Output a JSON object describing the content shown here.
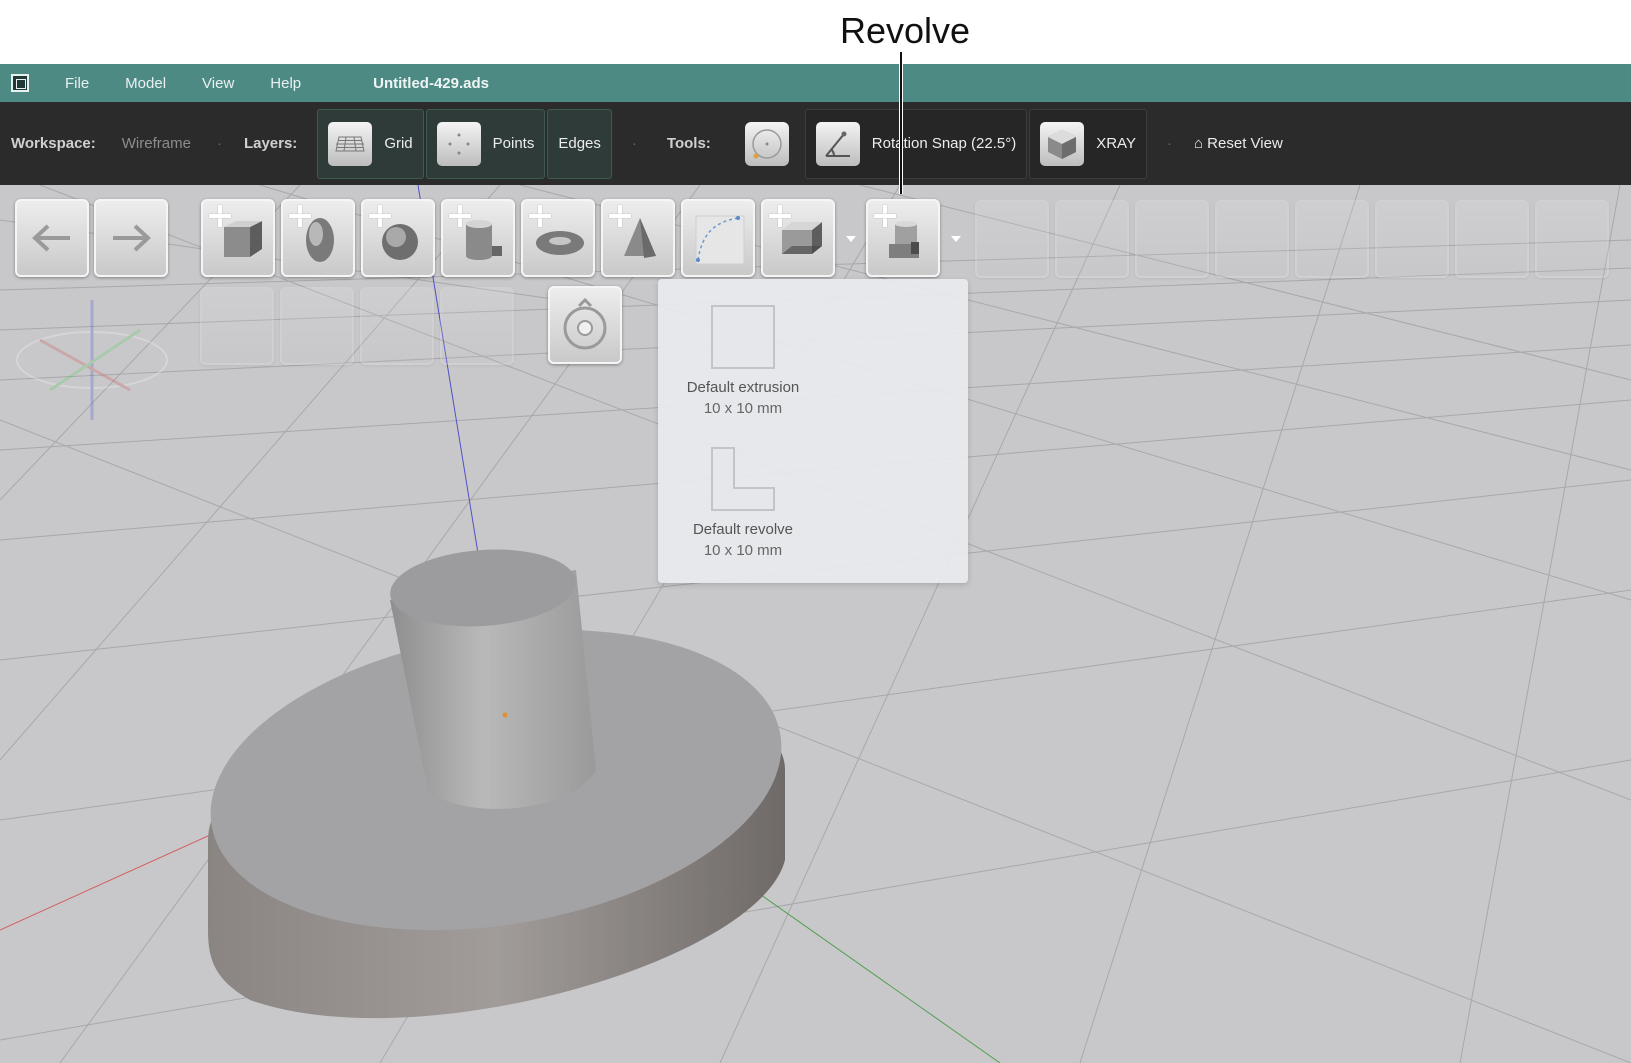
{
  "annotation": {
    "label": "Revolve"
  },
  "menubar": {
    "items": [
      "File",
      "Model",
      "View",
      "Help"
    ],
    "document_title": "Untitled-429.ads"
  },
  "toolbar": {
    "workspace_label": "Workspace:",
    "workspace_value": "Wireframe",
    "layers_label": "Layers:",
    "layers": [
      {
        "label": "Grid",
        "icon": "grid-icon",
        "active": true
      },
      {
        "label": "Points",
        "icon": "points-icon",
        "active": true
      },
      {
        "label": "Edges",
        "icon": "",
        "active": true
      }
    ],
    "tools_label": "Tools:",
    "rotation_snap_label": "Rotation Snap (22.5°)",
    "xray_label": "XRAY",
    "reset_view_label": "⌂ Reset View"
  },
  "tool_buttons": [
    {
      "name": "undo-button",
      "icon": "arrow-left-icon"
    },
    {
      "name": "redo-button",
      "icon": "arrow-right-icon"
    },
    {
      "name": "add-box-button",
      "icon": "box-icon"
    },
    {
      "name": "add-ellipsoid-button",
      "icon": "ellipsoid-icon"
    },
    {
      "name": "add-sphere-button",
      "icon": "sphere-icon"
    },
    {
      "name": "add-cylinder-button",
      "icon": "cylinder-icon"
    },
    {
      "name": "add-torus-button",
      "icon": "torus-icon"
    },
    {
      "name": "add-cone-button",
      "icon": "cone-icon"
    },
    {
      "name": "add-curve-button",
      "icon": "curve-icon"
    },
    {
      "name": "add-extrusion-button",
      "icon": "extrusion-icon"
    },
    {
      "name": "add-revolve-button",
      "icon": "revolve-icon"
    }
  ],
  "dropdown": {
    "items": [
      {
        "title": "Default extrusion",
        "size": "10 x 10 mm",
        "icon": "square-profile-icon"
      },
      {
        "title": "Default revolve",
        "size": "10 x 10 mm",
        "icon": "l-profile-icon"
      }
    ]
  },
  "colors": {
    "menubar": "#4e8a84",
    "toolbar": "#2b2b2b",
    "viewport": "#c8c8cb",
    "x_axis": "#d46060",
    "y_axis": "#50a050",
    "z_axis": "#5050c8"
  }
}
